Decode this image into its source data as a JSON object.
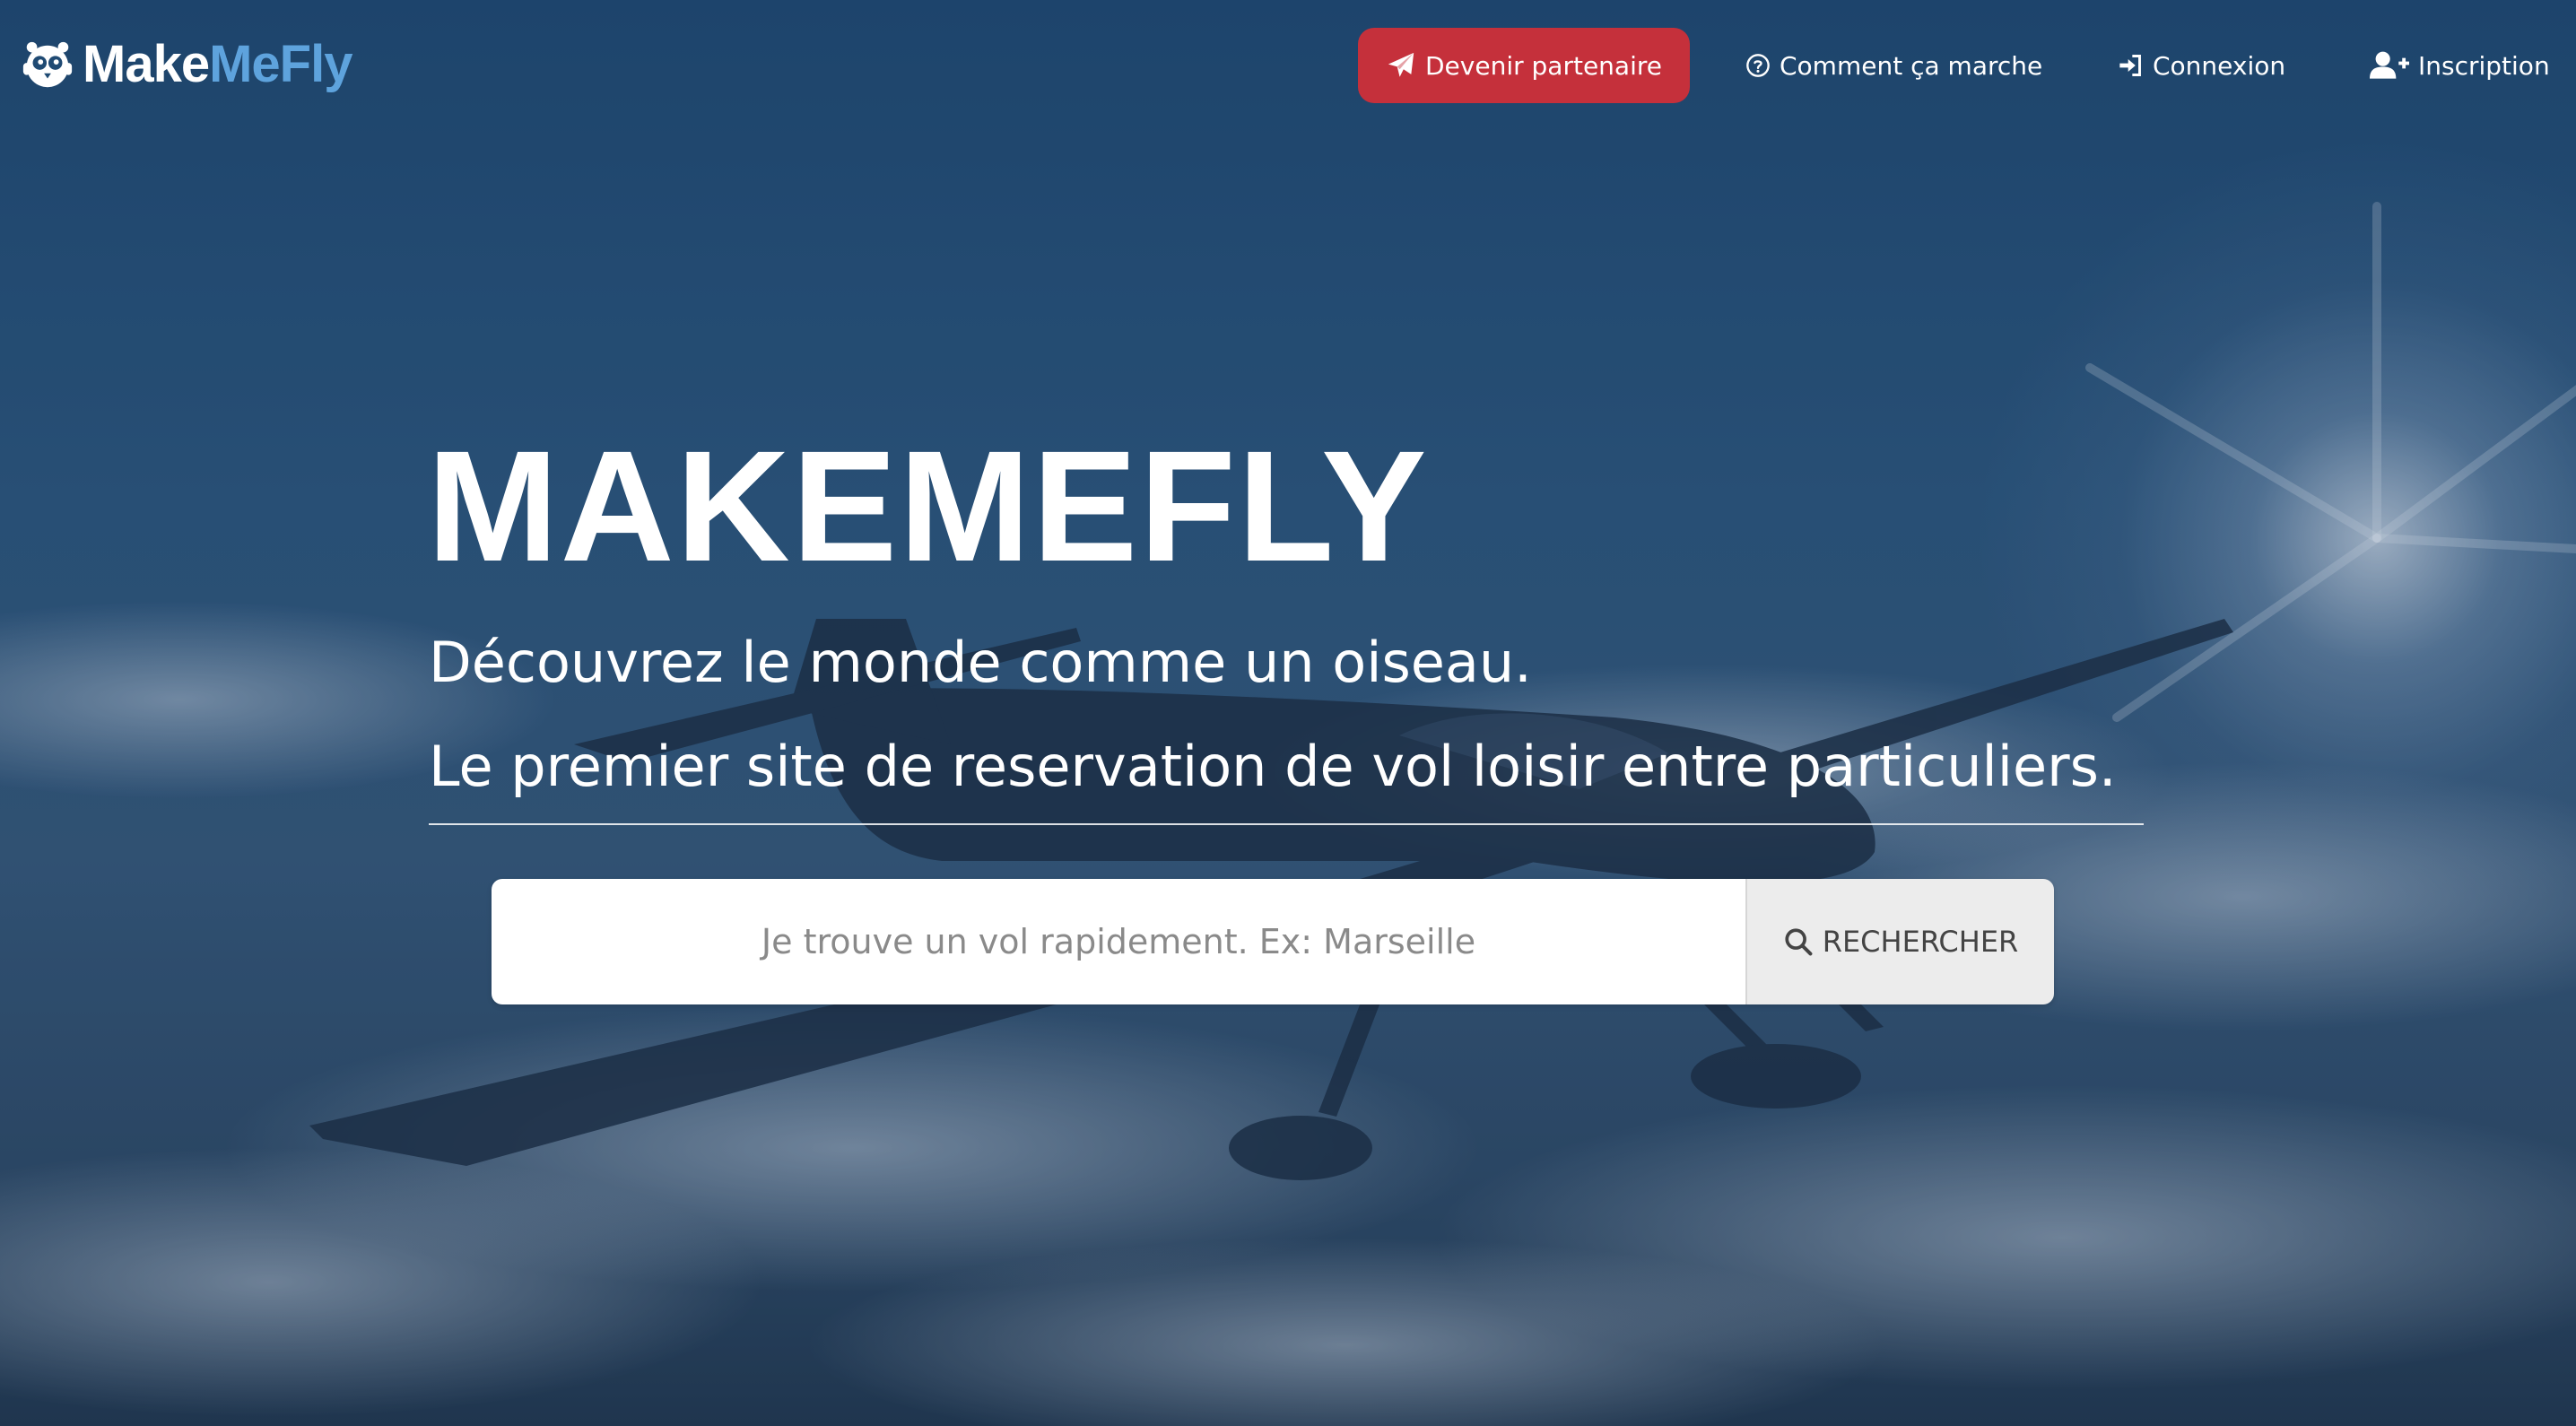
{
  "brand": {
    "logo_part1": "Make",
    "logo_part2": "MeFly",
    "logo_icon": "owl-mascot-icon"
  },
  "nav": {
    "partner_label": "Devenir partenaire",
    "partner_icon": "paper-plane-icon",
    "how_label": "Comment ça marche",
    "how_icon": "question-circle-icon",
    "login_label": "Connexion",
    "login_icon": "sign-in-icon",
    "signup_label": "Inscription",
    "signup_icon": "user-plus-icon"
  },
  "hero": {
    "title": "MAKEMEFLY",
    "subtitle_1": "Découvrez le monde comme un oiseau.",
    "subtitle_2": "Le premier site de reservation de vol loisir entre particuliers."
  },
  "search": {
    "placeholder": "Je trouve un vol rapidement. Ex: Marseille",
    "value": "",
    "button_label": "RECHERCHER",
    "button_icon": "search-icon"
  },
  "colors": {
    "partner_button": "#c5303b",
    "logo_accent": "#5ea3dd",
    "background": "#2c577e"
  }
}
